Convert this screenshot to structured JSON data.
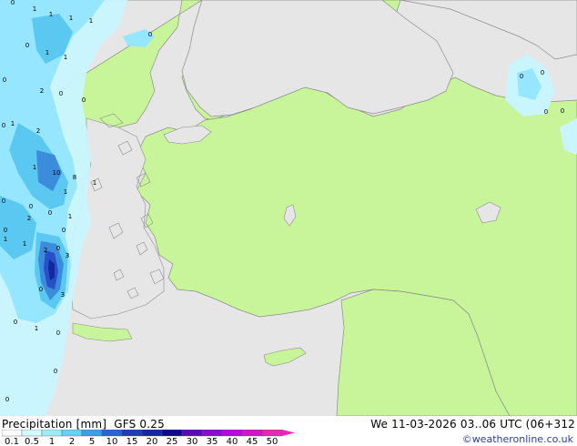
{
  "title": {
    "product": "Precipitation [mm]",
    "model": "GFS 0.25",
    "valid": "We 11-03-2026 03..06 UTC (06+312",
    "credit": "©weatheronline.co.uk"
  },
  "colors": {
    "sea": "#e6e6e6",
    "land": "#c8f59a",
    "coast": "#8c8c8c",
    "precip": [
      "#c8f5ff",
      "#96e6ff",
      "#5ac8f0",
      "#3c8cdc",
      "#2850c8",
      "#1428a0",
      "#0a0a7a"
    ]
  },
  "legend": {
    "labels": [
      "0.1",
      "0.5",
      "1",
      "2",
      "5",
      "10",
      "15",
      "20",
      "25",
      "30",
      "35",
      "40",
      "45",
      "50"
    ],
    "colors": [
      "#ffffff",
      "#d2faff",
      "#a0eaff",
      "#64d2f5",
      "#3ca0e6",
      "#2864d2",
      "#1e3cb4",
      "#1428a0",
      "#0a0a8c",
      "#5a0ab4",
      "#8c0ad2",
      "#b40adc",
      "#d214c8",
      "#e628b4"
    ]
  },
  "value_labels": [
    "1",
    "1",
    "1",
    "0",
    "1",
    "0",
    "0",
    "1",
    "1",
    "0",
    "2",
    "0",
    "0",
    "2",
    "1",
    "0",
    "10",
    "1",
    "8",
    "1",
    "1",
    "0",
    "0",
    "2",
    "0",
    "1",
    "1",
    "2",
    "0",
    "1",
    "0",
    "0",
    "3",
    "3",
    "0",
    "1",
    "0",
    "0",
    "0",
    "0",
    "0",
    "0",
    "0",
    "0"
  ]
}
